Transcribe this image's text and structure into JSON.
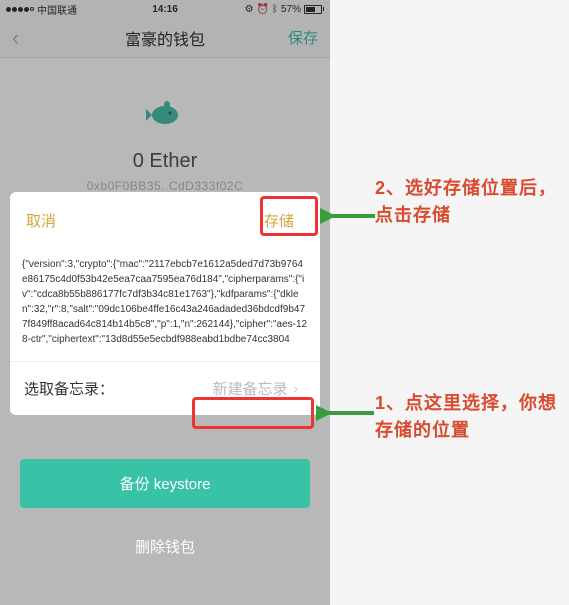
{
  "statusBar": {
    "carrier": "中国联通",
    "time": "14:16",
    "battery": "57%"
  },
  "nav": {
    "title": "富豪的钱包",
    "save": "保存"
  },
  "wallet": {
    "balance": "0 Ether",
    "address": "0xb0F0BB35..CdD333f02C"
  },
  "modal": {
    "cancel": "取消",
    "save": "存储",
    "body": "{\"version\":3,\"crypto\":{\"mac\":\"2117ebcb7e1612a5ded7d73b9764e86175c4d0f53b42e5ea7caa7595ea76d184\",\"cipherparams\":{\"iv\":\"cdca8b55b886177fc7df3b34c81e1763\"},\"kdfparams\":{\"dklen\":32,\"r\":8,\"salt\":\"09dc106be4ffe16c43a246adaded36bdcdf9b477f849ff8acad64c814b14b5c8\",\"p\":1,\"n\":262144},\"cipher\":\"aes-128-ctr\",\"ciphertext\":\"13d8d55e5ecbdf988eabd1bdbe74cc3804",
    "footerLabel": "选取备忘录：",
    "memoSelect": "新建备忘录"
  },
  "buttons": {
    "backup": "备份 keystore",
    "delete": "删除钱包"
  },
  "annotations": {
    "step1": "1、点这里选择，你想存储的位置",
    "step2": "2、选好存储位置后，点击存储"
  },
  "colors": {
    "accent": "#38c3a7",
    "warning": "#d94b2f",
    "highlight": "#e33",
    "modalAction": "#d4a53e",
    "arrow": "#3a9c3a"
  }
}
